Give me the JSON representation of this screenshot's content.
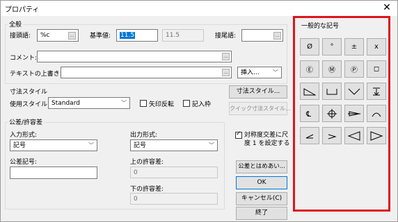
{
  "window": {
    "title": "プロパティ",
    "close_glyph": "✕"
  },
  "general": {
    "group_title": "全般",
    "prefix_label": "接頭語:",
    "prefix_value": "%c",
    "base_label": "基準値:",
    "base_value": "11.5",
    "base_display": "11.5",
    "suffix_label": "接尾語:",
    "suffix_value": "",
    "comment_label": "コメント:",
    "comment_value": "",
    "override_label": "テキストの上書き:",
    "override_value": "",
    "insert_label": "挿入...",
    "small_btn": "..."
  },
  "dim_style": {
    "group_title": "寸法スタイル",
    "use_label": "使用スタイル:",
    "use_value": "Standard",
    "reverse_arrow_label": "矢印反転",
    "reverse_arrow_checked": false,
    "record_frame_label": "記入枠",
    "record_frame_checked": false,
    "style_button": "寸法スタイル...",
    "quick_button": "クイック寸法スタイル..."
  },
  "tolerance": {
    "group_title": "公差/許容差",
    "input_format_label": "入力形式:",
    "input_format_value": "記号",
    "output_format_label": "出力形式:",
    "output_format_value": "記号",
    "symbol_label": "公差記号:",
    "symbol_value": "",
    "upper_label": "上の許容差:",
    "upper_value": "0",
    "lower_label": "下の許容差:",
    "lower_value": "0"
  },
  "symmetry": {
    "label_line1": "対称度交差に尺",
    "label_line2": "度 1 を設定する",
    "checked": true
  },
  "buttons": {
    "fit_button": "公差とはめあい...",
    "ok": "OK",
    "cancel": "キャンセル(C)",
    "end": "終了"
  },
  "symbols": {
    "title": "一般的な記号",
    "row1": [
      "Ø",
      "°",
      "±",
      "x"
    ],
    "row2": [
      "Ⓔ",
      "Ⓜ",
      "Ⓟ",
      "◻"
    ],
    "row3": [
      "slope-icon",
      "counterbore-icon",
      "countersink-icon",
      "depth-icon"
    ],
    "row4": [
      "centerline-icon",
      "center-mark-icon",
      "conical-taper-icon",
      "arc-length-icon"
    ],
    "row5": [
      "angle-left-icon",
      "angle-right-icon",
      "taper-left-icon",
      "taper-right-icon"
    ]
  }
}
